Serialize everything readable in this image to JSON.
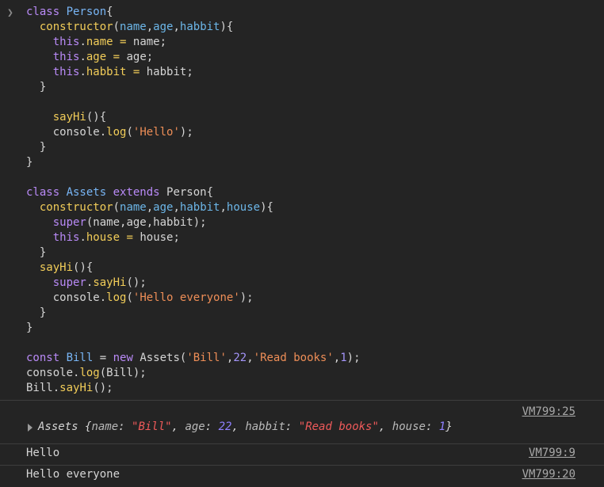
{
  "console": {
    "prompt_icon": "chevron-right-icon",
    "code_lines": [
      [
        {
          "t": "kw",
          "v": "class "
        },
        {
          "t": "cls",
          "v": "Person"
        },
        {
          "t": "txt",
          "v": "{"
        }
      ],
      [
        {
          "t": "txt",
          "v": "  "
        },
        {
          "t": "fn",
          "v": "constructor"
        },
        {
          "t": "txt",
          "v": "("
        },
        {
          "t": "par",
          "v": "name"
        },
        {
          "t": "txt",
          "v": ","
        },
        {
          "t": "par",
          "v": "age"
        },
        {
          "t": "txt",
          "v": ","
        },
        {
          "t": "par",
          "v": "habbit"
        },
        {
          "t": "txt",
          "v": "){"
        }
      ],
      [
        {
          "t": "txt",
          "v": "    "
        },
        {
          "t": "kw",
          "v": "this"
        },
        {
          "t": "txt",
          "v": "."
        },
        {
          "t": "prop",
          "v": "name"
        },
        {
          "t": "txt",
          "v": " "
        },
        {
          "t": "prop",
          "v": "="
        },
        {
          "t": "txt",
          "v": " name;"
        }
      ],
      [
        {
          "t": "txt",
          "v": "    "
        },
        {
          "t": "kw",
          "v": "this"
        },
        {
          "t": "txt",
          "v": "."
        },
        {
          "t": "prop",
          "v": "age"
        },
        {
          "t": "txt",
          "v": " "
        },
        {
          "t": "prop",
          "v": "="
        },
        {
          "t": "txt",
          "v": " age;"
        }
      ],
      [
        {
          "t": "txt",
          "v": "    "
        },
        {
          "t": "kw",
          "v": "this"
        },
        {
          "t": "txt",
          "v": "."
        },
        {
          "t": "prop",
          "v": "habbit"
        },
        {
          "t": "txt",
          "v": " "
        },
        {
          "t": "prop",
          "v": "="
        },
        {
          "t": "txt",
          "v": " habbit;"
        }
      ],
      [
        {
          "t": "txt",
          "v": "  }"
        }
      ],
      [
        {
          "t": "txt",
          "v": ""
        }
      ],
      [
        {
          "t": "txt",
          "v": "    "
        },
        {
          "t": "fn",
          "v": "sayHi"
        },
        {
          "t": "txt",
          "v": "(){"
        }
      ],
      [
        {
          "t": "txt",
          "v": "    console."
        },
        {
          "t": "fn",
          "v": "log"
        },
        {
          "t": "txt",
          "v": "("
        },
        {
          "t": "str",
          "v": "'Hello'"
        },
        {
          "t": "txt",
          "v": ");"
        }
      ],
      [
        {
          "t": "txt",
          "v": "  }"
        }
      ],
      [
        {
          "t": "txt",
          "v": "}"
        }
      ],
      [
        {
          "t": "txt",
          "v": ""
        }
      ],
      [
        {
          "t": "kw",
          "v": "class "
        },
        {
          "t": "cls",
          "v": "Assets"
        },
        {
          "t": "kw",
          "v": " extends "
        },
        {
          "t": "txt",
          "v": "Person{"
        }
      ],
      [
        {
          "t": "txt",
          "v": "  "
        },
        {
          "t": "fn",
          "v": "constructor"
        },
        {
          "t": "txt",
          "v": "("
        },
        {
          "t": "par",
          "v": "name"
        },
        {
          "t": "txt",
          "v": ","
        },
        {
          "t": "par",
          "v": "age"
        },
        {
          "t": "txt",
          "v": ","
        },
        {
          "t": "par",
          "v": "habbit"
        },
        {
          "t": "txt",
          "v": ","
        },
        {
          "t": "par",
          "v": "house"
        },
        {
          "t": "txt",
          "v": "){"
        }
      ],
      [
        {
          "t": "txt",
          "v": "    "
        },
        {
          "t": "kw",
          "v": "super"
        },
        {
          "t": "txt",
          "v": "(name,age,habbit);"
        }
      ],
      [
        {
          "t": "txt",
          "v": "    "
        },
        {
          "t": "kw",
          "v": "this"
        },
        {
          "t": "txt",
          "v": "."
        },
        {
          "t": "prop",
          "v": "house"
        },
        {
          "t": "txt",
          "v": " "
        },
        {
          "t": "prop",
          "v": "="
        },
        {
          "t": "txt",
          "v": " house;"
        }
      ],
      [
        {
          "t": "txt",
          "v": "  }"
        }
      ],
      [
        {
          "t": "txt",
          "v": "  "
        },
        {
          "t": "fn",
          "v": "sayHi"
        },
        {
          "t": "txt",
          "v": "(){"
        }
      ],
      [
        {
          "t": "txt",
          "v": "    "
        },
        {
          "t": "kw",
          "v": "super"
        },
        {
          "t": "txt",
          "v": "."
        },
        {
          "t": "fn",
          "v": "sayHi"
        },
        {
          "t": "txt",
          "v": "();"
        }
      ],
      [
        {
          "t": "txt",
          "v": "    console."
        },
        {
          "t": "fn",
          "v": "log"
        },
        {
          "t": "txt",
          "v": "("
        },
        {
          "t": "str",
          "v": "'Hello everyone'"
        },
        {
          "t": "txt",
          "v": ");"
        }
      ],
      [
        {
          "t": "txt",
          "v": "  }"
        }
      ],
      [
        {
          "t": "txt",
          "v": "}"
        }
      ],
      [
        {
          "t": "txt",
          "v": ""
        }
      ],
      [
        {
          "t": "kw",
          "v": "const "
        },
        {
          "t": "cls",
          "v": "Bill"
        },
        {
          "t": "txt",
          "v": " = "
        },
        {
          "t": "kw",
          "v": "new "
        },
        {
          "t": "txt",
          "v": "Assets("
        },
        {
          "t": "str",
          "v": "'Bill'"
        },
        {
          "t": "txt",
          "v": ","
        },
        {
          "t": "num",
          "v": "22"
        },
        {
          "t": "txt",
          "v": ","
        },
        {
          "t": "str",
          "v": "'Read books'"
        },
        {
          "t": "txt",
          "v": ","
        },
        {
          "t": "num",
          "v": "1"
        },
        {
          "t": "txt",
          "v": ");"
        }
      ],
      [
        {
          "t": "txt",
          "v": "console."
        },
        {
          "t": "fn",
          "v": "log"
        },
        {
          "t": "txt",
          "v": "(Bill);"
        }
      ],
      [
        {
          "t": "txt",
          "v": "Bill."
        },
        {
          "t": "fn",
          "v": "sayHi"
        },
        {
          "t": "txt",
          "v": "();"
        }
      ]
    ],
    "object_output": {
      "source": "VM799:25",
      "class_name": "Assets",
      "open_brace": " {",
      "name_key": "name",
      "name_val": "\"Bill\"",
      "age_key": "age",
      "age_val": "22",
      "habbit_key": "habbit",
      "habbit_val": "\"Read books\"",
      "house_key": "house",
      "house_val": "1",
      "close_brace": "}",
      "sep1": ": ",
      "comma": ", "
    },
    "log1": {
      "text": "Hello",
      "source": "VM799:9"
    },
    "log2": {
      "text": "Hello everyone",
      "source": "VM799:20"
    }
  }
}
